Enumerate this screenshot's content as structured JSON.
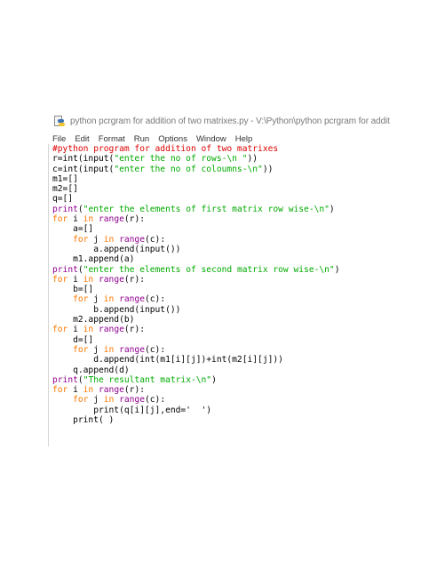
{
  "window": {
    "title": "python pcrgram for addition of two  matrixes.py - V:\\Python\\python pcrgram for addit"
  },
  "menu": [
    "File",
    "Edit",
    "Format",
    "Run",
    "Options",
    "Window",
    "Help"
  ],
  "colors": {
    "keyword": "#ff7700",
    "string": "#00aa00",
    "comment": "#dd0000",
    "builtin": "#900090",
    "default": "#000000"
  },
  "code": [
    [
      [
        "cm",
        "#python program for addition of two matrixes"
      ]
    ],
    [
      [
        "df",
        "r=int(input("
      ],
      [
        "str",
        "\"enter the no of rows-\\n \""
      ],
      [
        "df",
        "))"
      ]
    ],
    [
      [
        "df",
        "c=int(input("
      ],
      [
        "str",
        "\"enter the no of coloumns-\\n\""
      ],
      [
        "df",
        "))"
      ]
    ],
    [
      [
        "df",
        "m1=[]"
      ]
    ],
    [
      [
        "df",
        "m2=[]"
      ]
    ],
    [
      [
        "df",
        "q=[]"
      ]
    ],
    [
      [
        "bi",
        "print"
      ],
      [
        "df",
        "("
      ],
      [
        "str",
        "\"enter the elements of first matrix row wise-\\n\""
      ],
      [
        "df",
        ")"
      ]
    ],
    [
      [
        "kw",
        "for"
      ],
      [
        "df",
        " i "
      ],
      [
        "kw",
        "in"
      ],
      [
        "df",
        " "
      ],
      [
        "bi",
        "range"
      ],
      [
        "df",
        "(r):"
      ]
    ],
    [
      [
        "df",
        "    a=[]"
      ]
    ],
    [
      [
        "df",
        "    "
      ],
      [
        "kw",
        "for"
      ],
      [
        "df",
        " j "
      ],
      [
        "kw",
        "in"
      ],
      [
        "df",
        " "
      ],
      [
        "bi",
        "range"
      ],
      [
        "df",
        "(c):"
      ]
    ],
    [
      [
        "df",
        "        a.append(input())"
      ]
    ],
    [
      [
        "df",
        "    m1.append(a)"
      ]
    ],
    [
      [
        "bi",
        "print"
      ],
      [
        "df",
        "("
      ],
      [
        "str",
        "\"enter the elements of second matrix row wise-\\n\""
      ],
      [
        "df",
        ")"
      ]
    ],
    [
      [
        "kw",
        "for"
      ],
      [
        "df",
        " i "
      ],
      [
        "kw",
        "in"
      ],
      [
        "df",
        " "
      ],
      [
        "bi",
        "range"
      ],
      [
        "df",
        "(r):"
      ]
    ],
    [
      [
        "df",
        "    b=[]"
      ]
    ],
    [
      [
        "df",
        "    "
      ],
      [
        "kw",
        "for"
      ],
      [
        "df",
        " j "
      ],
      [
        "kw",
        "in"
      ],
      [
        "df",
        " "
      ],
      [
        "bi",
        "range"
      ],
      [
        "df",
        "(c):"
      ]
    ],
    [
      [
        "df",
        "        b.append(input())"
      ]
    ],
    [
      [
        "df",
        "    m2.append(b)"
      ]
    ],
    [
      [
        "kw",
        "for"
      ],
      [
        "df",
        " i "
      ],
      [
        "kw",
        "in"
      ],
      [
        "df",
        " "
      ],
      [
        "bi",
        "range"
      ],
      [
        "df",
        "(r):"
      ]
    ],
    [
      [
        "df",
        "    d=[]"
      ]
    ],
    [
      [
        "df",
        "    "
      ],
      [
        "kw",
        "for"
      ],
      [
        "df",
        " j "
      ],
      [
        "kw",
        "in"
      ],
      [
        "df",
        " "
      ],
      [
        "bi",
        "range"
      ],
      [
        "df",
        "(c):"
      ]
    ],
    [
      [
        "df",
        "        d.append(int(m1[i][j])+int(m2[i][j]))"
      ]
    ],
    [
      [
        "df",
        "    q.append(d)"
      ]
    ],
    [
      [
        "bi",
        "print"
      ],
      [
        "df",
        "("
      ],
      [
        "str",
        "\"The resultant matrix-\\n\""
      ],
      [
        "df",
        ")"
      ]
    ],
    [
      [
        "kw",
        "for"
      ],
      [
        "df",
        " i "
      ],
      [
        "kw",
        "in"
      ],
      [
        "df",
        " "
      ],
      [
        "bi",
        "range"
      ],
      [
        "df",
        "(r):"
      ]
    ],
    [
      [
        "df",
        "    "
      ],
      [
        "kw",
        "for"
      ],
      [
        "df",
        " j "
      ],
      [
        "kw",
        "in"
      ],
      [
        "df",
        " "
      ],
      [
        "bi",
        "range"
      ],
      [
        "df",
        "(c):"
      ]
    ],
    [
      [
        "df",
        "        print(q[i][j],end='  ')"
      ]
    ],
    [
      [
        "df",
        "    print( )"
      ]
    ]
  ]
}
